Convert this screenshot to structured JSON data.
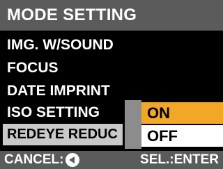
{
  "screen": {
    "title": "MODE SETTING",
    "menu": [
      {
        "label": "IMG. W/SOUND"
      },
      {
        "label": "FOCUS"
      },
      {
        "label": "DATE IMPRINT"
      },
      {
        "label": "ISO SETTING"
      },
      {
        "label": "REDEYE REDUC",
        "selected": true
      }
    ],
    "submenu": {
      "options": [
        {
          "label": "ON",
          "highlighted": true
        },
        {
          "label": "OFF"
        }
      ]
    },
    "footer": {
      "cancel_label": "CANCEL:",
      "cancel_icon": "left-arrow-button-icon",
      "select_label": "SEL.:ENTER"
    },
    "colors": {
      "title_bar": "#5b5b5b",
      "selected_row": "#c9c9c9",
      "highlight": "#f2a727",
      "option_bg": "#ffffff"
    }
  }
}
